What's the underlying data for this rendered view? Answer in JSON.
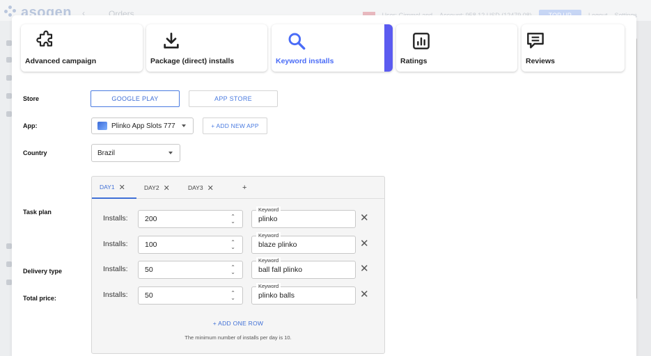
{
  "background": {
    "logo": "asogen",
    "breadcrumb": "Orders",
    "top_right": [
      "User: Gimmel and",
      "Account: 958.12 USD (12479.08)",
      "Logout",
      "Settings"
    ],
    "topup_label": "TOP UP"
  },
  "campaign_tabs": [
    {
      "label": "Advanced campaign",
      "icon": "puzzle-icon",
      "active": false
    },
    {
      "label": "Package (direct) installs",
      "icon": "download-icon",
      "active": false
    },
    {
      "label": "Keyword installs",
      "icon": "search-icon",
      "active": true
    },
    {
      "label": "Ratings",
      "icon": "chart-icon",
      "active": false
    },
    {
      "label": "Reviews",
      "icon": "comment-icon",
      "active": false
    }
  ],
  "labels": {
    "store": "Store",
    "app": "App:",
    "country": "Country",
    "task_plan": "Task plan",
    "delivery_type": "Delivery type",
    "total_price": "Total price:"
  },
  "store": {
    "google_play": "GOOGLE PLAY",
    "app_store": "APP STORE",
    "selected": "GOOGLE PLAY"
  },
  "app": {
    "selected": "Plinko App Slots 777",
    "add_new": "+ ADD NEW APP"
  },
  "country": {
    "selected": "Brazil"
  },
  "task_plan": {
    "days": [
      {
        "label": "DAY1",
        "active": true
      },
      {
        "label": "DAY2",
        "active": false
      },
      {
        "label": "DAY3",
        "active": false
      }
    ],
    "add_day": "+",
    "installs_label": "Installs:",
    "keyword_label": "Keyword",
    "rows": [
      {
        "installs": "200",
        "keyword": "plinko"
      },
      {
        "installs": "100",
        "keyword": "blaze plinko"
      },
      {
        "installs": "50",
        "keyword": "ball fall plinko"
      },
      {
        "installs": "50",
        "keyword": "plinko balls"
      }
    ],
    "add_row": "+ ADD ONE ROW",
    "note": "The minimum number of installs per day is 10."
  },
  "colors": {
    "accent": "#3f6fd6",
    "active_bar": "#5b5bf0"
  }
}
